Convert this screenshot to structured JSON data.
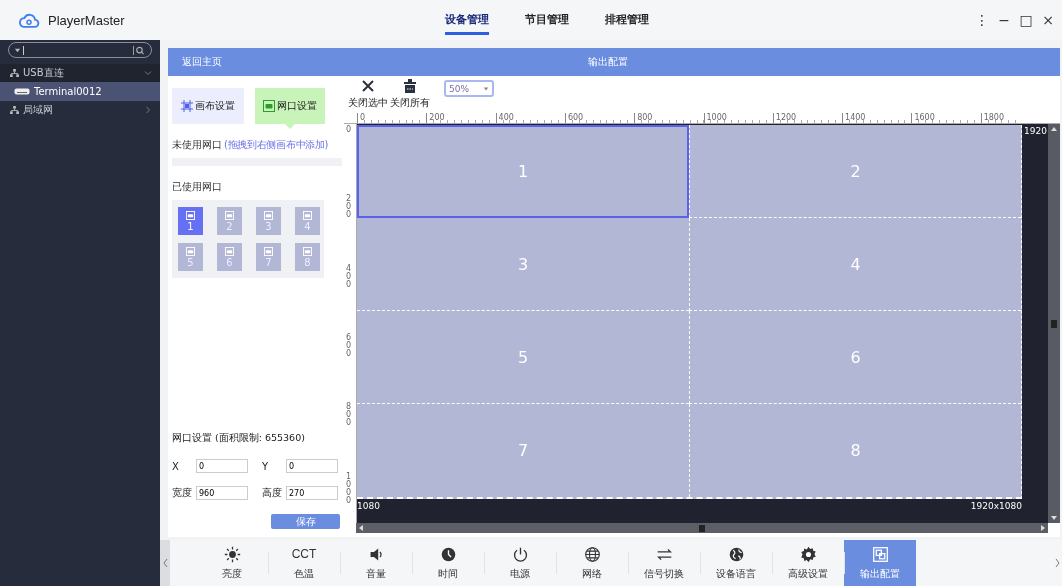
{
  "app": {
    "title": "PlayerMaster"
  },
  "nav_tabs": [
    {
      "label": "设备管理",
      "selected": true
    },
    {
      "label": "节目管理",
      "selected": false
    },
    {
      "label": "排程管理",
      "selected": false
    }
  ],
  "window_controls": [
    "⋮",
    "−",
    "□",
    "×"
  ],
  "sidebar": {
    "items": [
      {
        "label": "USB直连",
        "expanded": true,
        "selected": false,
        "children": [
          {
            "label": "Terminal0012",
            "selected": true
          }
        ]
      },
      {
        "label": "局域网",
        "expanded": false,
        "selected": false
      }
    ]
  },
  "header": {
    "back": "返回主页",
    "title": "输出配置"
  },
  "mode_buttons": [
    {
      "label": "画布设置",
      "selected": false
    },
    {
      "label": "网口设置",
      "selected": true
    }
  ],
  "unused_ports": {
    "label": "未使用网口",
    "hint": "(拖拽到右侧画布中添加)"
  },
  "used_ports": {
    "label": "已使用网口",
    "ports": [
      {
        "number": "1",
        "selected": true
      },
      {
        "number": "2",
        "selected": false
      },
      {
        "number": "3",
        "selected": false
      },
      {
        "number": "4",
        "selected": false
      },
      {
        "number": "5",
        "selected": false
      },
      {
        "number": "6",
        "selected": false
      },
      {
        "number": "7",
        "selected": false
      },
      {
        "number": "8",
        "selected": false
      }
    ]
  },
  "port_settings": {
    "title": "网口设置 (面积限制: 655360)",
    "fields": [
      {
        "label": "X",
        "value": "0"
      },
      {
        "label": "Y",
        "value": "0"
      },
      {
        "label": "宽度",
        "value": "960"
      },
      {
        "label": "高度",
        "value": "270"
      }
    ],
    "save": "保存"
  },
  "toolbar": {
    "close_selected": "关闭选中",
    "close_all": "关闭所有",
    "zoom": "50%"
  },
  "canvas": {
    "x_ticks": [
      "0",
      "200",
      "400",
      "600",
      "800",
      "1000",
      "1200",
      "1400",
      "1600",
      "1800"
    ],
    "y_ticks": [
      "0",
      "200",
      "400",
      "600",
      "800",
      "1000"
    ],
    "width_label": "1920",
    "height_label": "1080",
    "size_label": "1920x1080",
    "cells": [
      {
        "label": "1",
        "selected": true
      },
      {
        "label": "2",
        "selected": false
      },
      {
        "label": "3",
        "selected": false
      },
      {
        "label": "4",
        "selected": false
      },
      {
        "label": "5",
        "selected": false
      },
      {
        "label": "6",
        "selected": false
      },
      {
        "label": "7",
        "selected": false
      },
      {
        "label": "8",
        "selected": false
      }
    ]
  },
  "bottom_bar": [
    {
      "kind": "sun",
      "label": "亮度",
      "selected": false
    },
    {
      "kind": "cct",
      "icon_text": "CCT",
      "label": "色温",
      "selected": false
    },
    {
      "kind": "speaker",
      "label": "音量",
      "selected": false
    },
    {
      "kind": "clock",
      "label": "时间",
      "selected": false
    },
    {
      "kind": "power",
      "label": "电源",
      "selected": false
    },
    {
      "kind": "globe",
      "label": "网络",
      "selected": false
    },
    {
      "kind": "swap",
      "label": "信号切换",
      "selected": false
    },
    {
      "kind": "earth",
      "label": "设备语言",
      "selected": false
    },
    {
      "kind": "gear",
      "label": "高级设置",
      "selected": false
    },
    {
      "kind": "output",
      "label": "输出配置",
      "selected": true
    }
  ]
}
